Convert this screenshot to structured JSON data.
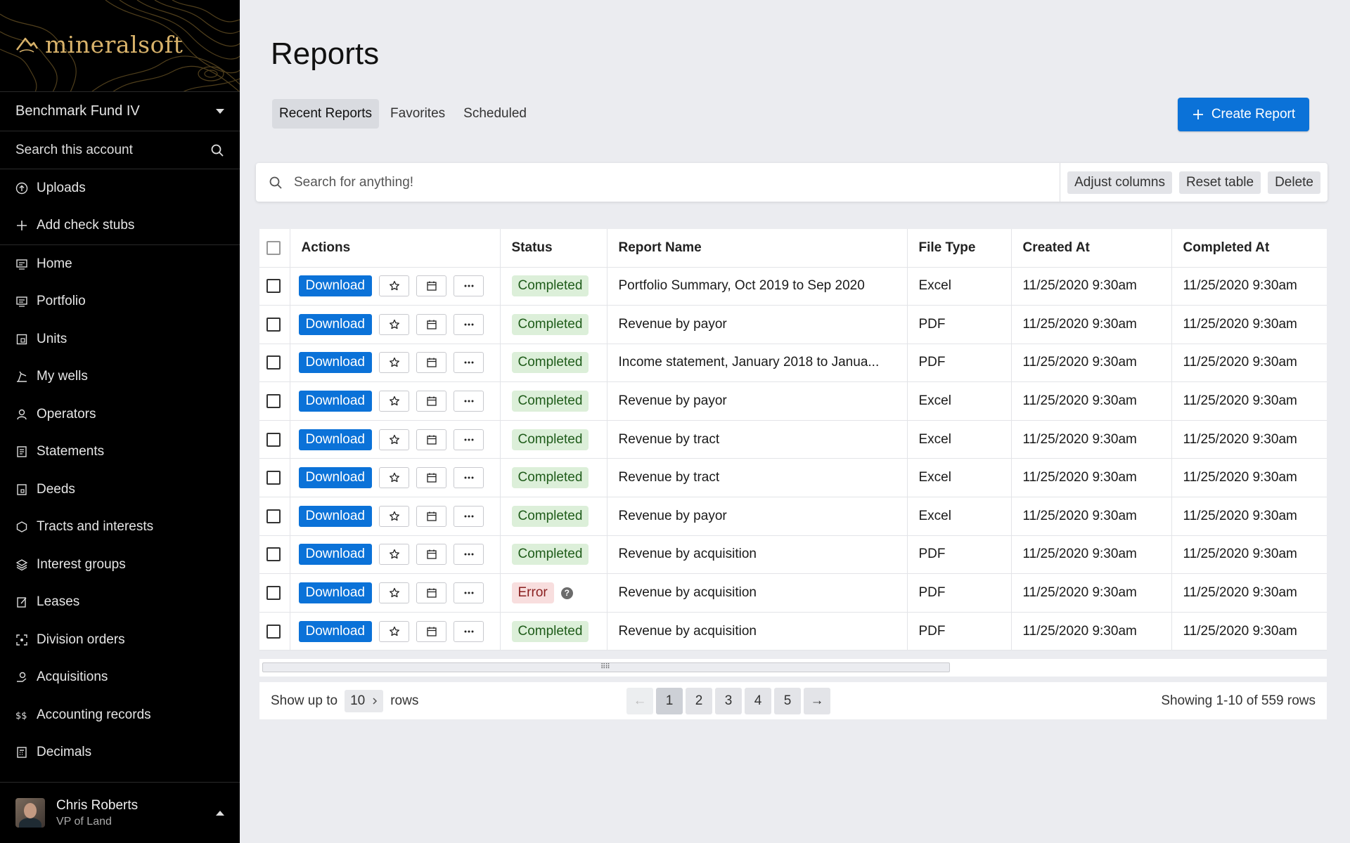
{
  "app": {
    "brand": "mineralsoft"
  },
  "account": {
    "name": "Benchmark Fund IV"
  },
  "sidebar_search": {
    "label": "Search this account"
  },
  "nav_top": [
    {
      "label": "Uploads",
      "icon": "upload-icon"
    },
    {
      "label": "Add check stubs",
      "icon": "plus-icon"
    }
  ],
  "nav_main": [
    {
      "label": "Home",
      "icon": "home-icon"
    },
    {
      "label": "Portfolio",
      "icon": "portfolio-icon"
    },
    {
      "label": "Units",
      "icon": "units-icon"
    },
    {
      "label": "My wells",
      "icon": "wells-icon"
    },
    {
      "label": "Operators",
      "icon": "operators-icon"
    },
    {
      "label": "Statements",
      "icon": "statements-icon"
    },
    {
      "label": "Deeds",
      "icon": "deeds-icon"
    },
    {
      "label": "Tracts and interests",
      "icon": "tracts-icon"
    },
    {
      "label": "Interest groups",
      "icon": "layers-icon"
    },
    {
      "label": "Leases",
      "icon": "leases-icon"
    },
    {
      "label": "Division orders",
      "icon": "division-icon"
    },
    {
      "label": "Acquisitions",
      "icon": "acquisitions-icon"
    },
    {
      "label": "Accounting records",
      "icon": "accounting-icon"
    },
    {
      "label": "Decimals",
      "icon": "decimals-icon"
    }
  ],
  "user": {
    "name": "Chris Roberts",
    "role": "VP of Land"
  },
  "page": {
    "title": "Reports"
  },
  "tabs": [
    {
      "label": "Recent Reports",
      "active": true
    },
    {
      "label": "Favorites",
      "active": false
    },
    {
      "label": "Scheduled",
      "active": false
    }
  ],
  "create_button": {
    "label": "Create Report"
  },
  "toolbar": {
    "search_placeholder": "Search for anything!",
    "adjust_label": "Adjust columns",
    "reset_label": "Reset table",
    "delete_label": "Delete"
  },
  "table": {
    "columns": [
      "Actions",
      "Status",
      "Report Name",
      "File Type",
      "Created At",
      "Completed At"
    ],
    "download_label": "Download",
    "rows": [
      {
        "status": "Completed",
        "status_kind": "completed",
        "name": "Portfolio Summary, Oct 2019 to Sep 2020",
        "type": "Excel",
        "created": "11/25/2020  9:30am",
        "completed": "11/25/2020  9:30am"
      },
      {
        "status": "Completed",
        "status_kind": "completed",
        "name": "Revenue by payor",
        "type": "PDF",
        "created": "11/25/2020  9:30am",
        "completed": "11/25/2020  9:30am"
      },
      {
        "status": "Completed",
        "status_kind": "completed",
        "name": "Income statement, January 2018 to Janua...",
        "type": "PDF",
        "created": "11/25/2020  9:30am",
        "completed": "11/25/2020  9:30am"
      },
      {
        "status": "Completed",
        "status_kind": "completed",
        "name": "Revenue by payor",
        "type": "Excel",
        "created": "11/25/2020  9:30am",
        "completed": "11/25/2020  9:30am"
      },
      {
        "status": "Completed",
        "status_kind": "completed",
        "name": "Revenue by tract",
        "type": "Excel",
        "created": "11/25/2020  9:30am",
        "completed": "11/25/2020  9:30am"
      },
      {
        "status": "Completed",
        "status_kind": "completed",
        "name": "Revenue by tract",
        "type": "Excel",
        "created": "11/25/2020  9:30am",
        "completed": "11/25/2020  9:30am"
      },
      {
        "status": "Completed",
        "status_kind": "completed",
        "name": "Revenue by payor",
        "type": "Excel",
        "created": "11/25/2020  9:30am",
        "completed": "11/25/2020  9:30am"
      },
      {
        "status": "Completed",
        "status_kind": "completed",
        "name": "Revenue by acquisition",
        "type": "PDF",
        "created": "11/25/2020  9:30am",
        "completed": "11/25/2020  9:30am"
      },
      {
        "status": "Error",
        "status_kind": "error",
        "name": "Revenue by acquisition",
        "type": "PDF",
        "created": "11/25/2020  9:30am",
        "completed": "11/25/2020  9:30am"
      },
      {
        "status": "Completed",
        "status_kind": "completed",
        "name": "Revenue by acquisition",
        "type": "PDF",
        "created": "11/25/2020  9:30am",
        "completed": "11/25/2020  9:30am"
      }
    ]
  },
  "pagination": {
    "show_prefix": "Show up to",
    "rows_value": "10",
    "rows_suffix": "rows",
    "prev": "←",
    "next": "→",
    "pages": [
      "1",
      "2",
      "3",
      "4",
      "5"
    ],
    "current": "1",
    "summary": "Showing 1-10 of 559 rows"
  },
  "colors": {
    "primary": "#0b72d8",
    "sidebar_bg": "#000000",
    "brand_gold": "#d9b36b",
    "success_bg": "#dcefd9",
    "error_bg": "#f8dede"
  }
}
